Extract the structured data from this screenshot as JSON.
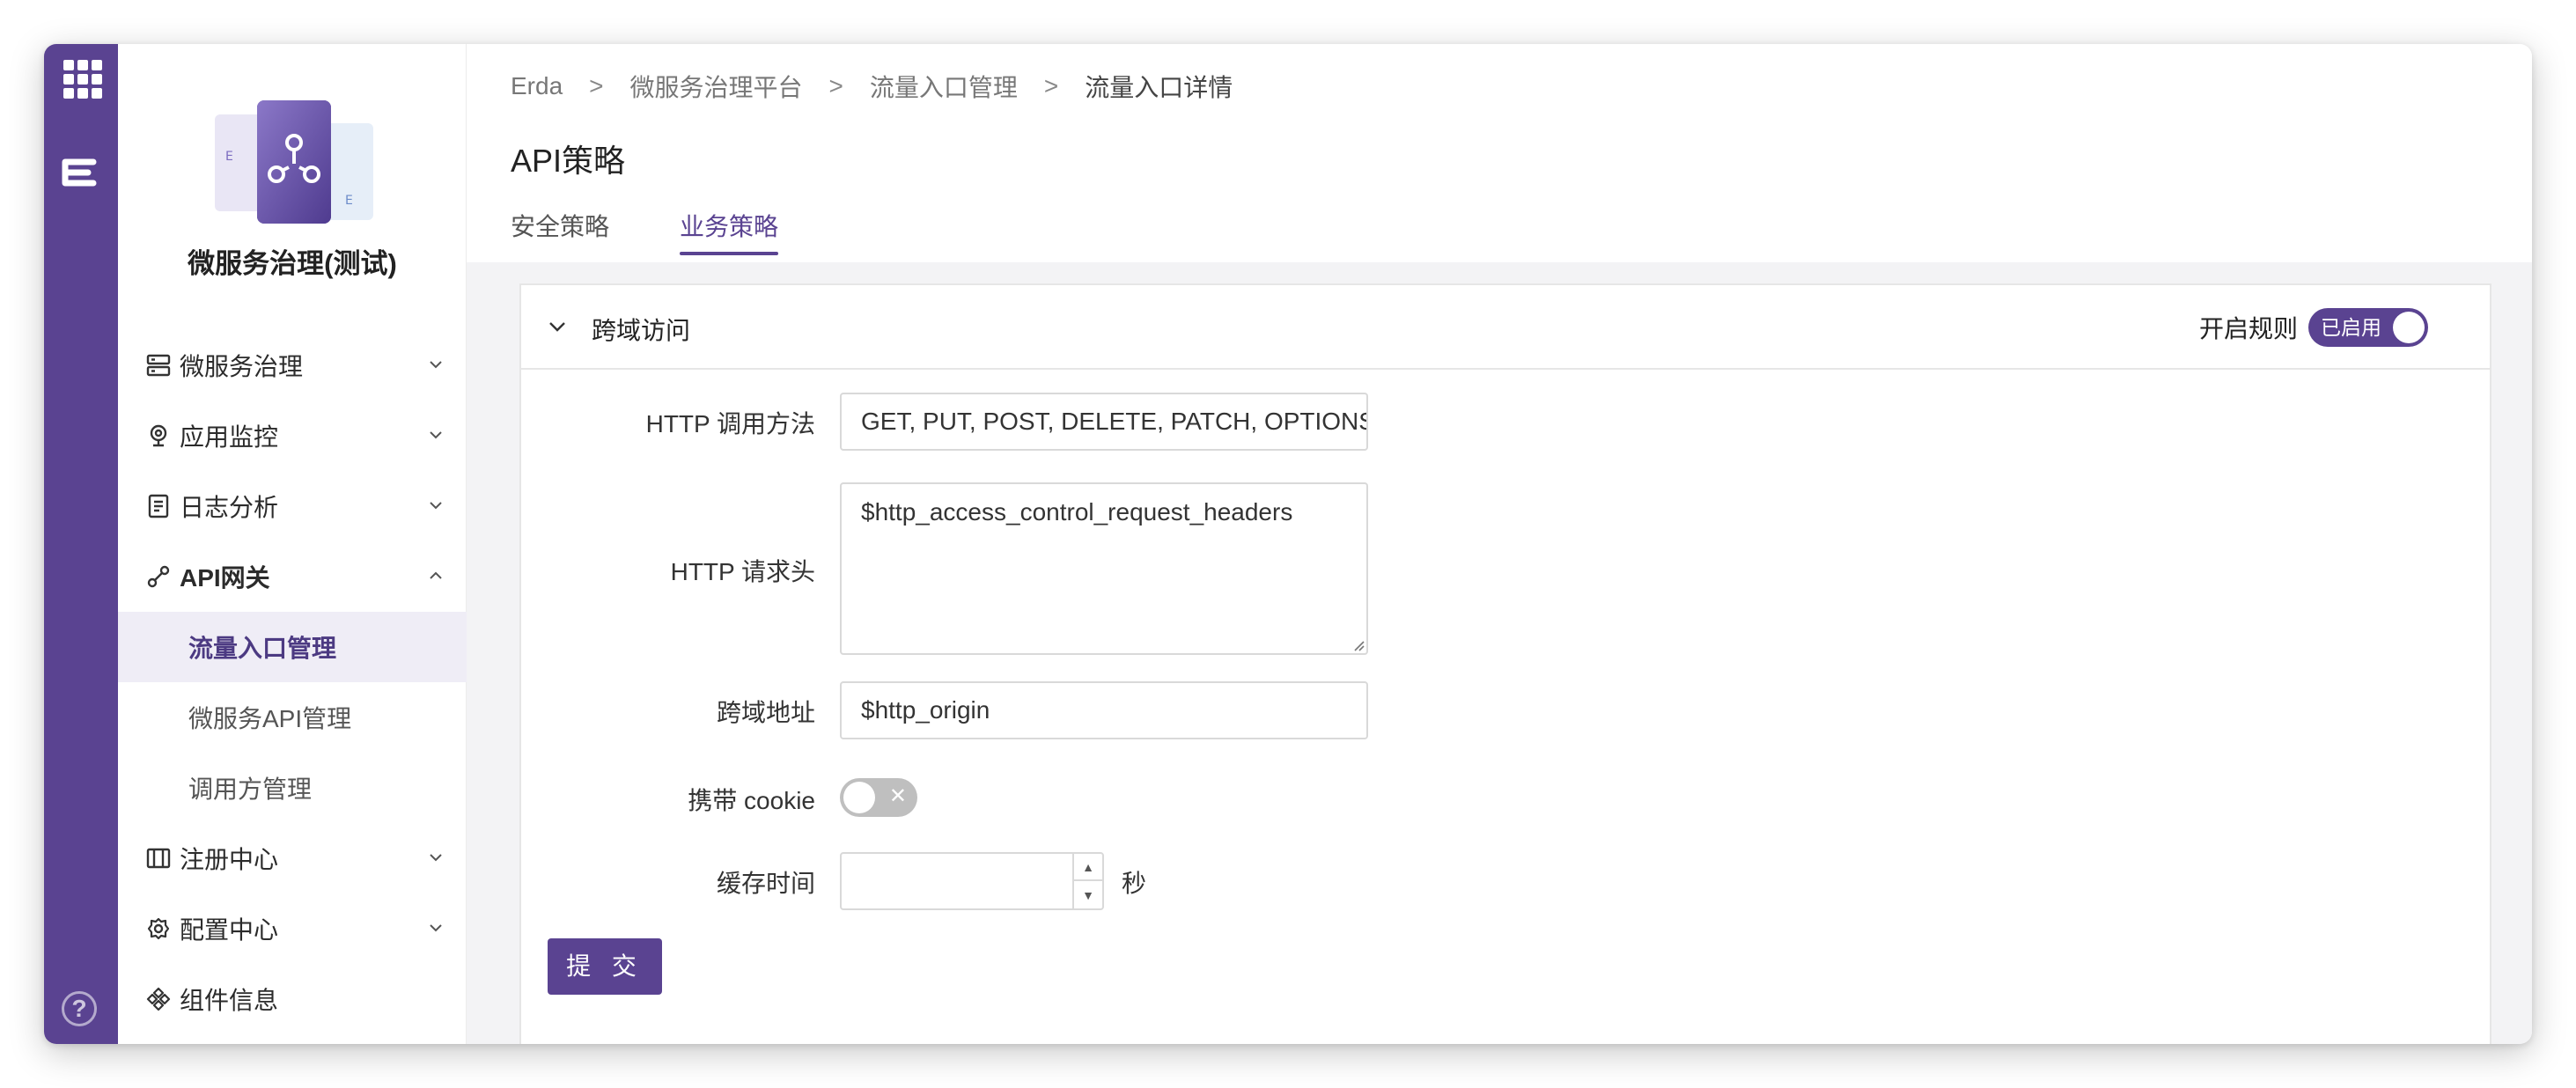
{
  "brand": {
    "app_name": "微服务治理(测试)",
    "accent": "#5a4391"
  },
  "rail": {
    "help_glyph": "?"
  },
  "sidebar": {
    "items": [
      {
        "label": "微服务治理",
        "icon": "server-icon"
      },
      {
        "label": "应用监控",
        "icon": "monitor-icon"
      },
      {
        "label": "日志分析",
        "icon": "log-icon"
      },
      {
        "label": "API网关",
        "icon": "gateway-icon",
        "expanded": true,
        "children": [
          {
            "label": "流量入口管理",
            "active": true
          },
          {
            "label": "微服务API管理"
          },
          {
            "label": "调用方管理"
          }
        ]
      },
      {
        "label": "注册中心",
        "icon": "registry-icon"
      },
      {
        "label": "配置中心",
        "icon": "config-icon"
      },
      {
        "label": "组件信息",
        "icon": "component-icon"
      }
    ]
  },
  "breadcrumb": [
    "Erda",
    "微服务治理平台",
    "流量入口管理",
    "流量入口详情"
  ],
  "page": {
    "title": "API策略",
    "tabs": [
      {
        "label": "安全策略",
        "active": false
      },
      {
        "label": "业务策略",
        "active": true
      }
    ]
  },
  "panel": {
    "title": "跨域访问",
    "rule_label": "开启规则",
    "rule_state": "已启用",
    "fields": {
      "methods": {
        "label": "HTTP 调用方法",
        "value": "GET, PUT, POST, DELETE, PATCH, OPTIONS"
      },
      "headers": {
        "label": "HTTP 请求头",
        "value": "$http_access_control_request_headers"
      },
      "origin": {
        "label": "跨域地址",
        "value": "$http_origin"
      },
      "cookie": {
        "label": "携带 cookie",
        "enabled": false
      },
      "cache": {
        "label": "缓存时间",
        "value": "",
        "unit": "秒"
      }
    },
    "submit_label": "提 交"
  }
}
